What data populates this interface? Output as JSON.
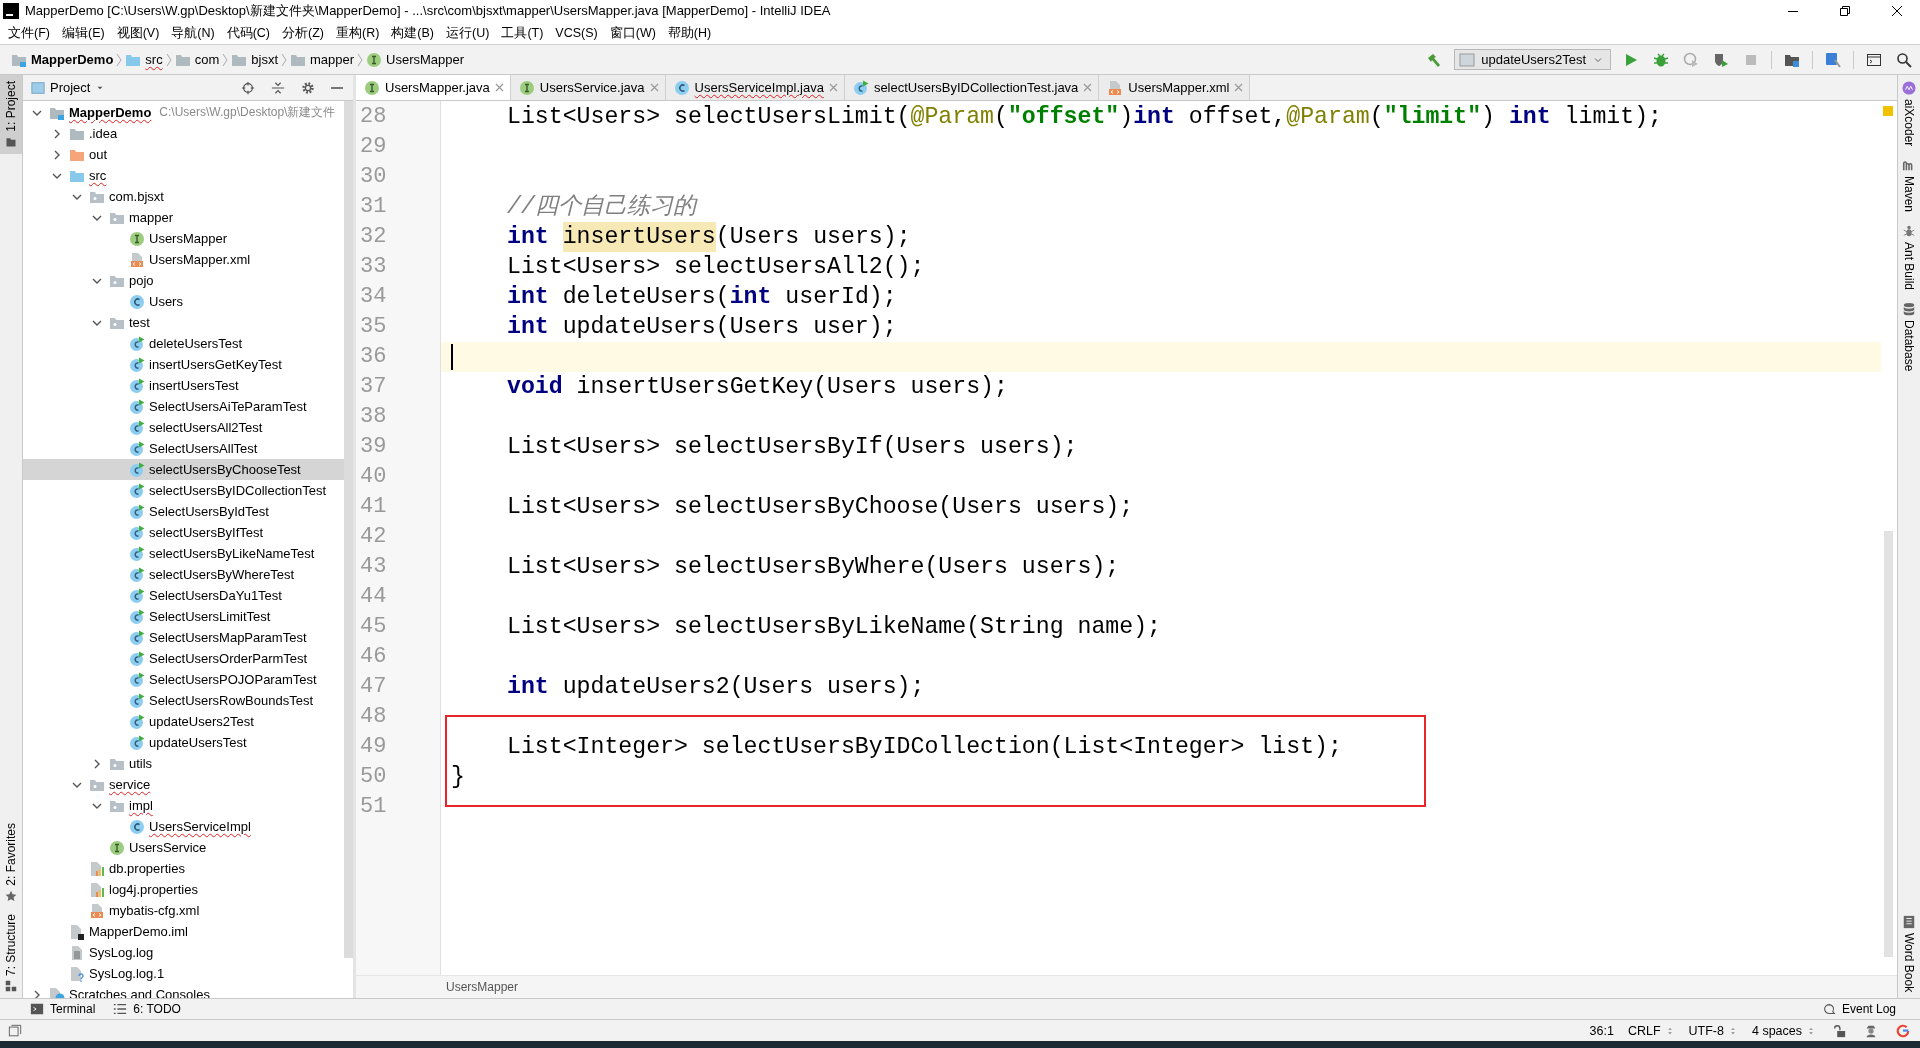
{
  "window": {
    "title": "MapperDemo [C:\\Users\\W.gp\\Desktop\\新建文件夹\\MapperDemo] - ...\\src\\com\\bjsxt\\mapper\\UsersMapper.java [MapperDemo] - IntelliJ IDEA"
  },
  "menu": [
    "文件(F)",
    "编辑(E)",
    "视图(V)",
    "导航(N)",
    "代码(C)",
    "分析(Z)",
    "重构(R)",
    "构建(B)",
    "运行(U)",
    "工具(T)",
    "VCS(S)",
    "窗口(W)",
    "帮助(H)"
  ],
  "breadcrumbs": [
    {
      "label": "MapperDemo",
      "kind": "module"
    },
    {
      "label": "src",
      "kind": "source-folder",
      "misspelled": true
    },
    {
      "label": "com",
      "kind": "folder"
    },
    {
      "label": "bjsxt",
      "kind": "folder"
    },
    {
      "label": "mapper",
      "kind": "folder"
    },
    {
      "label": "UsersMapper",
      "kind": "interface"
    }
  ],
  "run_config": {
    "label": "updateUsers2Test"
  },
  "left_tool_windows_top": [
    {
      "label": "1: Project",
      "kind": "project",
      "selected": true
    }
  ],
  "left_tool_windows_bottom": [
    {
      "label": "2: Favorites",
      "kind": "favorites",
      "selected": false
    },
    {
      "label": "7: Structure",
      "kind": "structure",
      "selected": false
    }
  ],
  "right_tool_windows_top": [
    {
      "label": "aiXcoder",
      "kind": "aixcoder"
    },
    {
      "label": "Maven",
      "kind": "maven"
    },
    {
      "label": "Ant Build",
      "kind": "ant"
    },
    {
      "label": "Database",
      "kind": "database"
    }
  ],
  "right_tool_windows_bottom": [
    {
      "label": "Word Book",
      "kind": "book"
    }
  ],
  "project_panel": {
    "title": "Project",
    "tree": [
      {
        "label": "MapperDemo",
        "kind": "module",
        "path": "C:\\Users\\W.gp\\Desktop\\新建文件",
        "expanded": true,
        "selected": false,
        "misspelled": true,
        "children": [
          {
            "label": ".idea",
            "kind": "folder",
            "expanded": false,
            "selected": false
          },
          {
            "label": "out",
            "kind": "excluded-folder",
            "expanded": false,
            "selected": false
          },
          {
            "label": "src",
            "kind": "source-folder",
            "expanded": true,
            "selected": false,
            "misspelled": true,
            "children": [
              {
                "label": "com.bjsxt",
                "kind": "package",
                "expanded": true,
                "selected": false,
                "children": [
                  {
                    "label": "mapper",
                    "kind": "package",
                    "expanded": true,
                    "selected": false,
                    "children": [
                      {
                        "label": "UsersMapper",
                        "kind": "interface",
                        "selected": false
                      },
                      {
                        "label": "UsersMapper.xml",
                        "kind": "xml",
                        "selected": false
                      }
                    ]
                  },
                  {
                    "label": "pojo",
                    "kind": "package",
                    "expanded": true,
                    "selected": false,
                    "children": [
                      {
                        "label": "Users",
                        "kind": "class",
                        "selected": false
                      }
                    ]
                  },
                  {
                    "label": "test",
                    "kind": "package",
                    "expanded": true,
                    "selected": false,
                    "children": [
                      {
                        "label": "deleteUsersTest",
                        "kind": "test-class",
                        "selected": false
                      },
                      {
                        "label": "insertUsersGetKeyTest",
                        "kind": "test-class",
                        "selected": false
                      },
                      {
                        "label": "insertUsersTest",
                        "kind": "test-class",
                        "selected": false
                      },
                      {
                        "label": "SelectUsersAiTeParamTest",
                        "kind": "test-class",
                        "selected": false
                      },
                      {
                        "label": "selectUsersAll2Test",
                        "kind": "test-class",
                        "selected": false
                      },
                      {
                        "label": "SelectUsersAllTest",
                        "kind": "test-class",
                        "selected": false
                      },
                      {
                        "label": "selectUsersByChooseTest",
                        "kind": "test-class",
                        "selected": true
                      },
                      {
                        "label": "selectUsersByIDCollectionTest",
                        "kind": "test-class",
                        "selected": false
                      },
                      {
                        "label": "SelectUsersByIdTest",
                        "kind": "test-class",
                        "selected": false
                      },
                      {
                        "label": "selectUsersByIfTest",
                        "kind": "test-class",
                        "selected": false
                      },
                      {
                        "label": "selectUsersByLikeNameTest",
                        "kind": "test-class",
                        "selected": false
                      },
                      {
                        "label": "selectUsersByWhereTest",
                        "kind": "test-class",
                        "selected": false
                      },
                      {
                        "label": "SelectUsersDaYu1Test",
                        "kind": "test-class",
                        "selected": false
                      },
                      {
                        "label": "SelectUsersLimitTest",
                        "kind": "test-class",
                        "selected": false
                      },
                      {
                        "label": "SelectUsersMapParamTest",
                        "kind": "test-class",
                        "selected": false
                      },
                      {
                        "label": "SelectUsersOrderParmTest",
                        "kind": "test-class",
                        "selected": false
                      },
                      {
                        "label": "SelectUsersPOJOParamTest",
                        "kind": "test-class",
                        "selected": false
                      },
                      {
                        "label": "SelectUsersRowBoundsTest",
                        "kind": "test-class",
                        "selected": false
                      },
                      {
                        "label": "updateUsers2Test",
                        "kind": "test-class",
                        "selected": false
                      },
                      {
                        "label": "updateUsersTest",
                        "kind": "test-class",
                        "selected": false
                      }
                    ]
                  },
                  {
                    "label": "utils",
                    "kind": "package",
                    "expanded": false,
                    "selected": false
                  }
                ]
              },
              {
                "label": "service",
                "kind": "package",
                "expanded": true,
                "selected": false,
                "misspelled": true,
                "children": [
                  {
                    "label": "impl",
                    "kind": "package",
                    "expanded": true,
                    "selected": false,
                    "misspelled": true,
                    "children": [
                      {
                        "label": "UsersServiceImpl",
                        "kind": "class",
                        "selected": false,
                        "misspelled": true
                      }
                    ]
                  },
                  {
                    "label": "UsersService",
                    "kind": "interface",
                    "selected": false
                  }
                ]
              },
              {
                "label": "db.properties",
                "kind": "properties",
                "selected": false
              },
              {
                "label": "log4j.properties",
                "kind": "properties",
                "selected": false
              },
              {
                "label": "mybatis-cfg.xml",
                "kind": "xml",
                "selected": false
              }
            ]
          },
          {
            "label": "MapperDemo.iml",
            "kind": "iml",
            "selected": false
          },
          {
            "label": "SysLog.log",
            "kind": "log",
            "selected": false
          },
          {
            "label": "SysLog.log.1",
            "kind": "unknown-file",
            "selected": false
          }
        ]
      },
      {
        "label": "Scratches and Consoles",
        "kind": "scratches",
        "expanded": false,
        "selected": false
      }
    ]
  },
  "editor": {
    "tabs": [
      {
        "label": "UsersMapper.java",
        "kind": "interface",
        "selected": true
      },
      {
        "label": "UsersService.java",
        "kind": "interface",
        "selected": false
      },
      {
        "label": "UsersServiceImpl.java",
        "kind": "class",
        "selected": false,
        "misspelled": true
      },
      {
        "label": "selectUsersByIDCollectionTest.java",
        "kind": "test-class",
        "selected": false
      },
      {
        "label": "UsersMapper.xml",
        "kind": "xml",
        "selected": false
      }
    ],
    "lines": [
      {
        "number": "28",
        "current": false,
        "boxed": false,
        "indented": true,
        "tokens": [
          {
            "text": "List<Users> selectUsersLimit(",
            "kind": "plain"
          },
          {
            "text": "@Param",
            "kind": "annotation"
          },
          {
            "text": "(",
            "kind": "plain"
          },
          {
            "text": "\"offset\"",
            "kind": "string"
          },
          {
            "text": ")",
            "kind": "plain"
          },
          {
            "text": "int",
            "kind": "keyword"
          },
          {
            "text": " offset,",
            "kind": "plain"
          },
          {
            "text": "@Param",
            "kind": "annotation"
          },
          {
            "text": "(",
            "kind": "plain"
          },
          {
            "text": "\"limit\"",
            "kind": "string"
          },
          {
            "text": ") ",
            "kind": "plain"
          },
          {
            "text": "int",
            "kind": "keyword"
          },
          {
            "text": " limit);",
            "kind": "plain"
          }
        ]
      },
      {
        "number": "29",
        "current": false,
        "boxed": false
      },
      {
        "number": "30",
        "current": false,
        "boxed": false
      },
      {
        "number": "31",
        "current": false,
        "boxed": false,
        "indented": true,
        "tokens": [
          {
            "text": "//四个自己练习的",
            "kind": "comment"
          }
        ]
      },
      {
        "number": "32",
        "current": false,
        "boxed": false,
        "indented": true,
        "tokens": [
          {
            "text": "int ",
            "kind": "keyword"
          },
          {
            "text": "insertUsers",
            "kind": "usage"
          },
          {
            "text": "(Users users);",
            "kind": "plain"
          }
        ]
      },
      {
        "number": "33",
        "current": false,
        "boxed": false,
        "indented": true,
        "tokens": [
          {
            "text": "List<Users> selectUsersAll2();",
            "kind": "plain"
          }
        ]
      },
      {
        "number": "34",
        "current": false,
        "boxed": false,
        "indented": true,
        "tokens": [
          {
            "text": "int",
            "kind": "keyword"
          },
          {
            "text": " deleteUsers(",
            "kind": "plain"
          },
          {
            "text": "int",
            "kind": "keyword"
          },
          {
            "text": " userId);",
            "kind": "plain"
          }
        ]
      },
      {
        "number": "35",
        "current": false,
        "boxed": false,
        "indented": true,
        "tokens": [
          {
            "text": "int",
            "kind": "keyword"
          },
          {
            "text": " updateUsers(Users user);",
            "kind": "plain"
          }
        ]
      },
      {
        "number": "36",
        "current": true,
        "boxed": false
      },
      {
        "number": "37",
        "current": false,
        "boxed": false,
        "indented": true,
        "tokens": [
          {
            "text": "void",
            "kind": "keyword"
          },
          {
            "text": " insertUsersGetKey(Users users);",
            "kind": "plain"
          }
        ]
      },
      {
        "number": "38",
        "current": false,
        "boxed": false
      },
      {
        "number": "39",
        "current": false,
        "boxed": false,
        "indented": true,
        "tokens": [
          {
            "text": "List<Users> selectUsersByIf(Users users);",
            "kind": "plain"
          }
        ]
      },
      {
        "number": "40",
        "current": false,
        "boxed": false
      },
      {
        "number": "41",
        "current": false,
        "boxed": false,
        "indented": true,
        "tokens": [
          {
            "text": "List<Users> selectUsersByChoose(Users users);",
            "kind": "plain"
          }
        ]
      },
      {
        "number": "42",
        "current": false,
        "boxed": false
      },
      {
        "number": "43",
        "current": false,
        "boxed": false,
        "indented": true,
        "tokens": [
          {
            "text": "List<Users> selectUsersByWhere(Users users);",
            "kind": "plain"
          }
        ]
      },
      {
        "number": "44",
        "current": false,
        "boxed": false
      },
      {
        "number": "45",
        "current": false,
        "boxed": false,
        "indented": true,
        "tokens": [
          {
            "text": "List<Users> selectUsersByLikeName(String name);",
            "kind": "plain"
          }
        ]
      },
      {
        "number": "46",
        "current": false,
        "boxed": false
      },
      {
        "number": "47",
        "current": false,
        "boxed": false,
        "indented": true,
        "tokens": [
          {
            "text": "int",
            "kind": "keyword"
          },
          {
            "text": " updateUsers2(Users users);",
            "kind": "plain"
          }
        ]
      },
      {
        "number": "48",
        "current": false,
        "boxed": false
      },
      {
        "number": "49",
        "current": false,
        "boxed": true,
        "indented": true,
        "tokens": [
          {
            "text": "List<Integer> selectUsersByIDCollection(List<Integer> list);",
            "kind": "plain"
          }
        ]
      },
      {
        "number": "50",
        "current": false,
        "boxed": true,
        "tokens": [
          {
            "text": "}",
            "kind": "plain"
          }
        ]
      },
      {
        "number": "51",
        "current": false,
        "boxed": false
      }
    ],
    "breadcrumb": "UsersMapper"
  },
  "bottom_tools": [
    {
      "label": "Terminal",
      "kind": "terminal"
    },
    {
      "label": "6: TODO",
      "kind": "todo"
    }
  ],
  "event_log": {
    "label": "Event Log"
  },
  "status_bar": {
    "position": "36:1",
    "line_separator": "CRLF",
    "encoding": "UTF-8",
    "indent": "4 spaces"
  }
}
